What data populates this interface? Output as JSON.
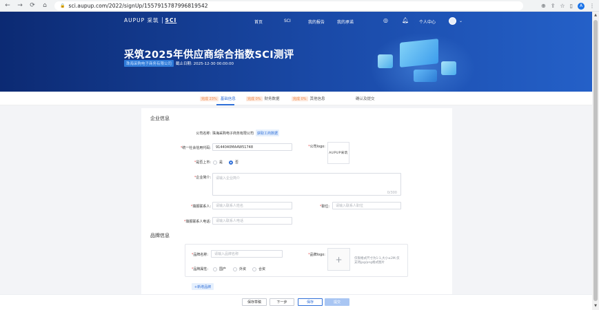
{
  "browser": {
    "url": "sci.aupup.com/2022/signUp/1557915787996819542",
    "back_icon": "arrow-left-icon",
    "forward_icon": "arrow-right-icon",
    "reload_icon": "reload-icon",
    "home_icon": "home-icon",
    "profile_initial": "A"
  },
  "nav": {
    "logo_text": "AUPUP 采筑",
    "logo_sci": "SCI",
    "items": [
      "首页",
      "SCI",
      "我的报告",
      "我的承诺"
    ],
    "personal_center": "个人中心"
  },
  "hero": {
    "title": "采筑2025年供应商综合指数SCI测评",
    "company": "珠海采购电子商务有限公司",
    "deadline_label": "截止日期:",
    "deadline_value": "2025-12-30 00:00:00"
  },
  "steps": [
    {
      "pct": "完成 23%",
      "label": "基础信息",
      "active": true
    },
    {
      "pct": "完成 0%",
      "label": "财务数据",
      "active": false
    },
    {
      "pct": "完成 0%",
      "label": "其他信息",
      "active": false
    },
    {
      "pct": "",
      "label": "确认及提交",
      "active": false
    }
  ],
  "form": {
    "section_company": "企业信息",
    "company_name_label": "公司名称:",
    "company_name_value": "珠海采购电子商务有限公司",
    "fetch_button": "获取工商数据",
    "credit_code_label": "统一社会信用代码:",
    "credit_code_value": "9144040MA4W51748",
    "company_logo_label": "公司logo:",
    "company_logo_text": "AUPUP采筑",
    "listed_label": "是否上市:",
    "listed_options": [
      "是",
      "否"
    ],
    "listed_selected": "否",
    "intro_label": "企业简介:",
    "intro_placeholder": "请输入企业简介",
    "intro_counter": "0/300",
    "contact_label": "填报联系人:",
    "contact_placeholder": "请输入联系人姓名",
    "position_label": "职位:",
    "position_placeholder": "请输入联系人职位",
    "phone_label": "填报联系人电话:",
    "phone_placeholder": "请输入联系人电话",
    "section_brand": "品牌信息",
    "brand_name_label": "品牌名称:",
    "brand_name_placeholder": "请输入品牌名称",
    "brand_logo_label": "品牌logo:",
    "brand_logo_hint": "仅限格式尺寸为1:1,大小≤2M,仅支持jpg/png格式图片",
    "brand_type_label": "品牌属性:",
    "brand_type_options": [
      "国产",
      "外资",
      "合资"
    ],
    "add_brand_button": "+新增品牌"
  },
  "footer": {
    "save_draft": "保存草稿",
    "next": "下一步",
    "save": "保存",
    "submit": "提交"
  }
}
